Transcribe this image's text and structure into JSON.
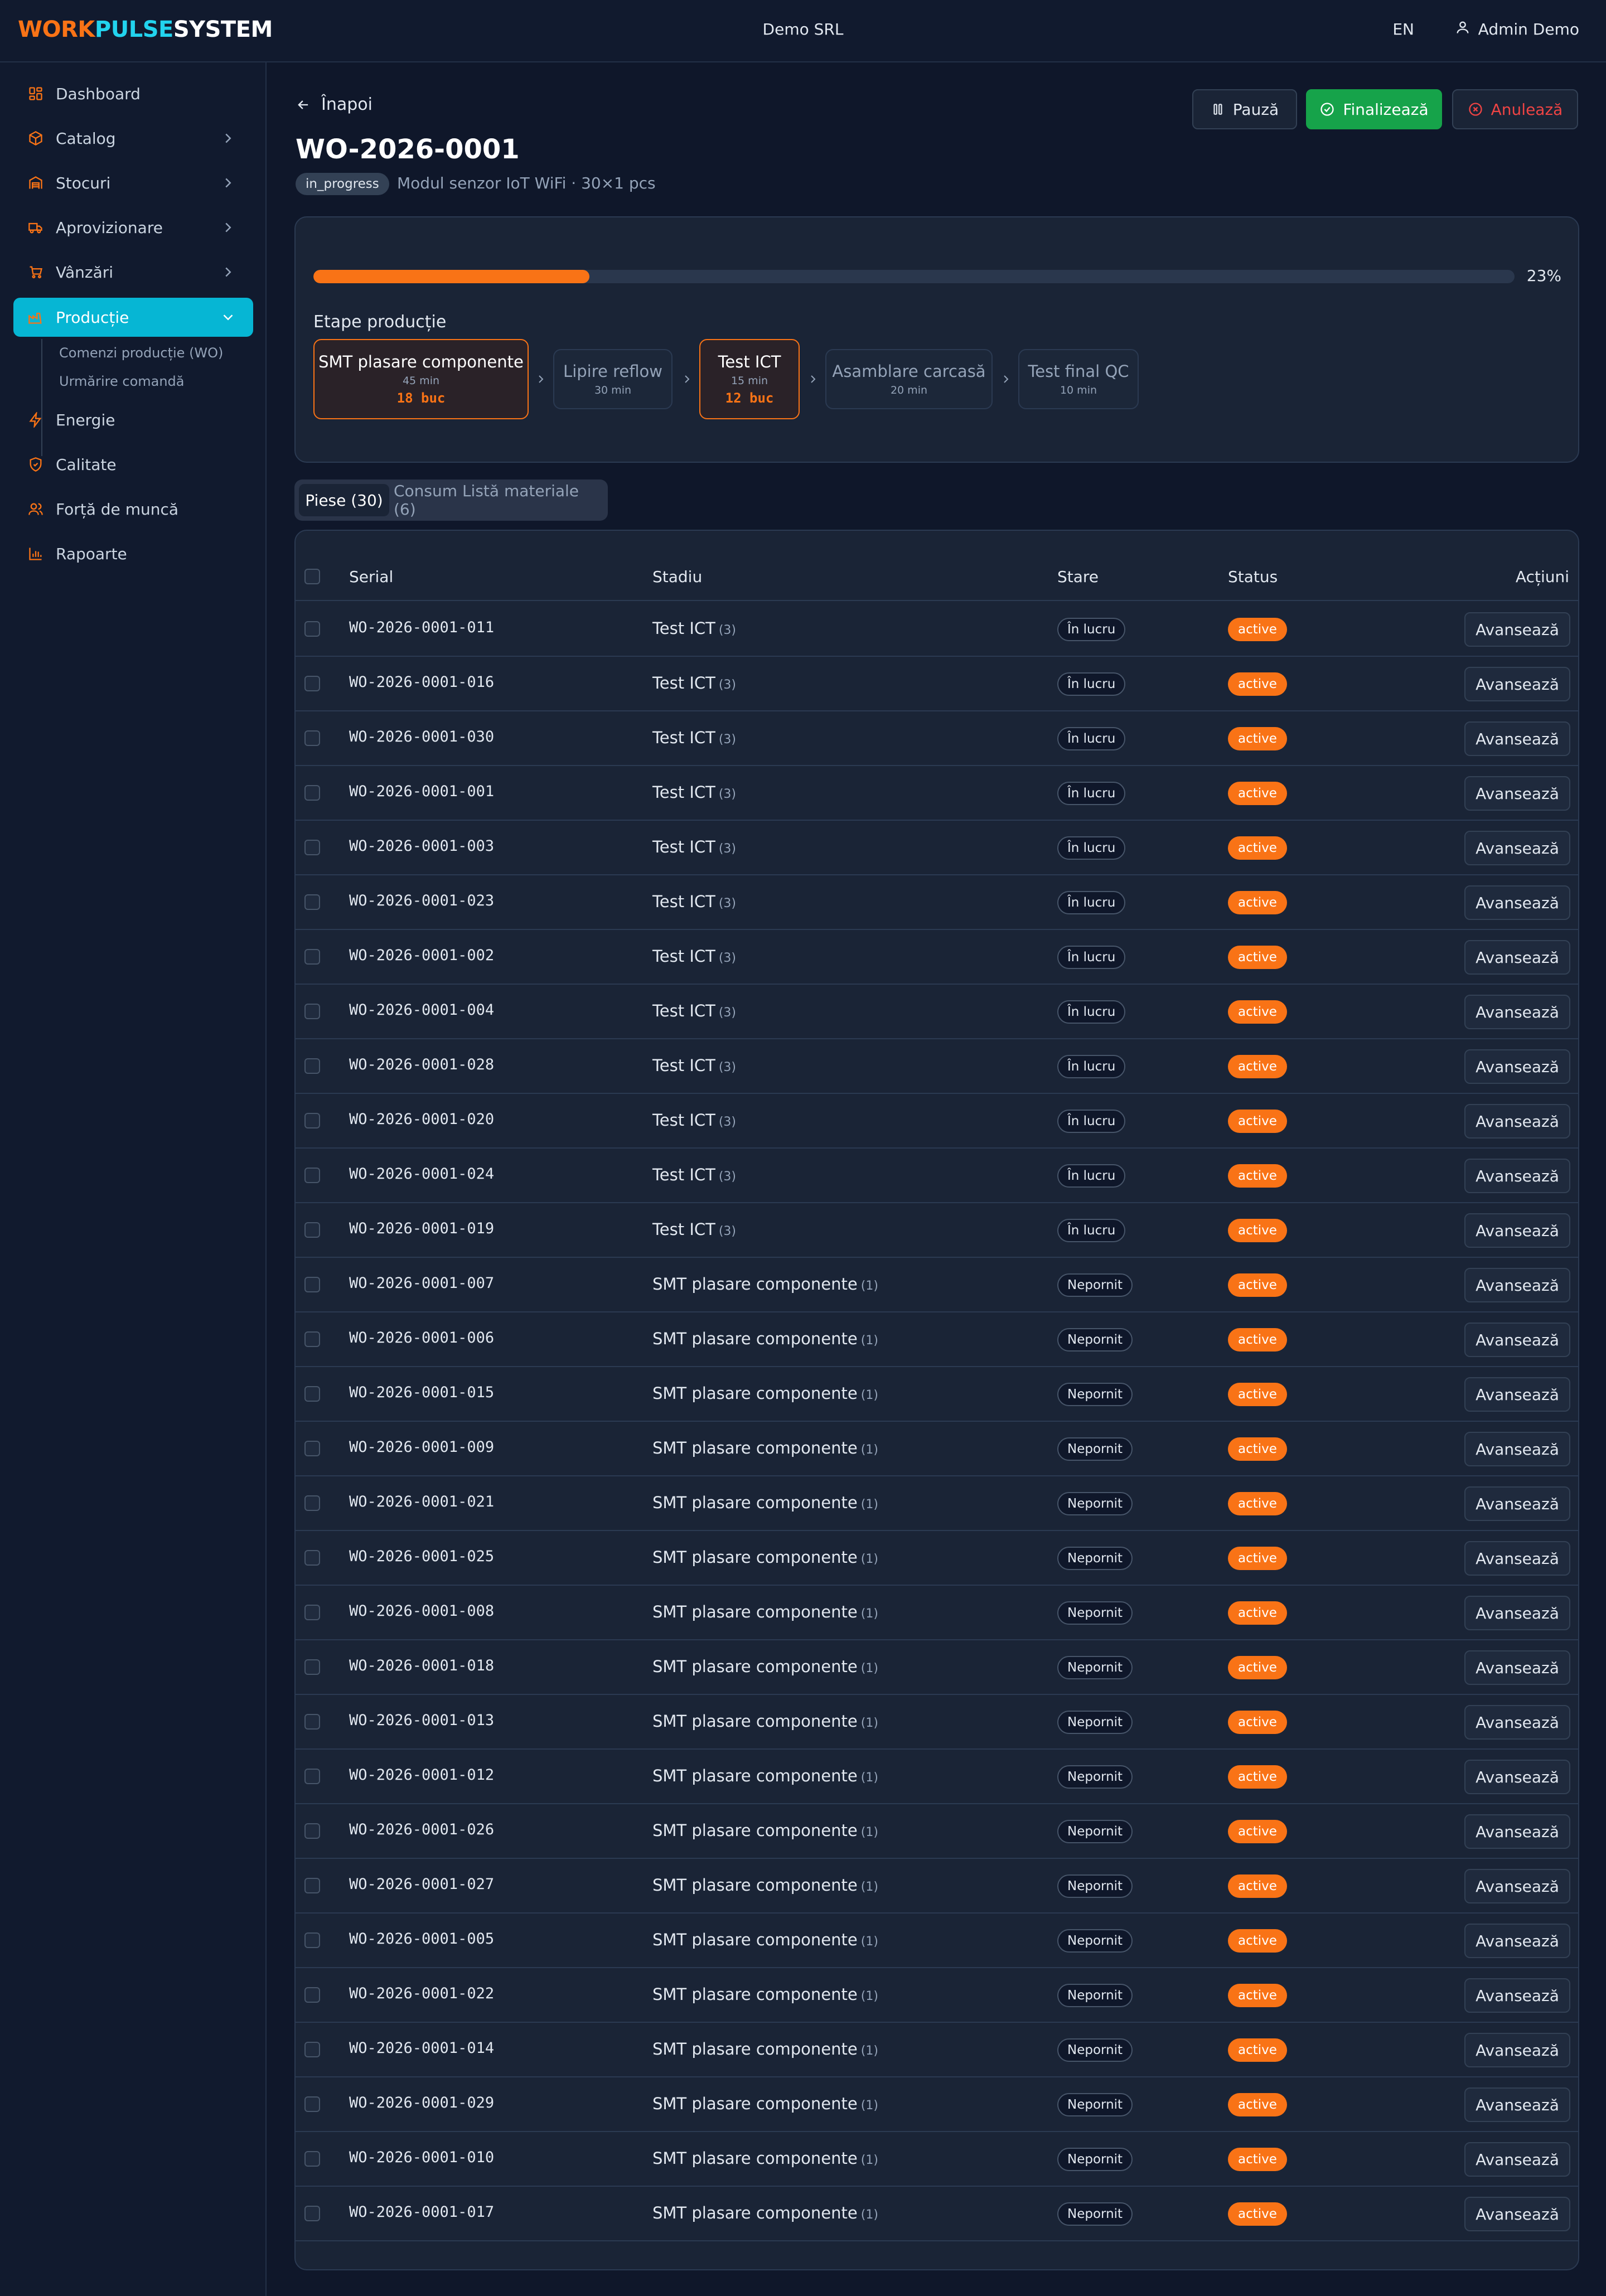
{
  "header": {
    "logo": {
      "part1": "WORK",
      "part2": "PULSE",
      "part3": "SYSTEM"
    },
    "company": "Demo SRL",
    "language": "EN",
    "user": "Admin Demo"
  },
  "sidebar": {
    "items": [
      {
        "label": "Dashboard",
        "icon": "grid-icon"
      },
      {
        "label": "Catalog",
        "icon": "box-icon"
      },
      {
        "label": "Stocuri",
        "icon": "warehouse-icon"
      },
      {
        "label": "Aprovizionare",
        "icon": "truck-icon"
      },
      {
        "label": "Vânzări",
        "icon": "cart-icon"
      },
      {
        "label": "Producție",
        "icon": "factory-icon"
      },
      {
        "label": "Energie",
        "icon": "bolt-icon"
      },
      {
        "label": "Calitate",
        "icon": "shield-icon"
      },
      {
        "label": "Forță de muncă",
        "icon": "users-icon"
      },
      {
        "label": "Rapoarte",
        "icon": "bar-chart-icon"
      }
    ],
    "subitems": [
      "Comenzi producție (WO)",
      "Urmărire comandă"
    ]
  },
  "page": {
    "back_label": "Înapoi",
    "title": "WO-2026-0001",
    "status_badge": "in_progress",
    "subtitle": "Modul senzor IoT WiFi · 30×1 pcs",
    "buttons": {
      "pause": "Pauză",
      "finish": "Finalizează",
      "cancel": "Anulează"
    },
    "progress_percent": 23,
    "progress_label": "23%",
    "stages_label": "Etape producție",
    "stages": [
      {
        "name": "SMT plasare componente",
        "duration": "45 min",
        "qty": "18 buc"
      },
      {
        "name": "Lipire reflow",
        "duration": "30 min",
        "qty": ""
      },
      {
        "name": "Test ICT",
        "duration": "15 min",
        "qty": "12 buc"
      },
      {
        "name": "Asamblare carcasă",
        "duration": "20 min",
        "qty": ""
      },
      {
        "name": "Test final QC",
        "duration": "10 min",
        "qty": ""
      }
    ],
    "tabs": [
      "Piese (30)",
      "Consum Listă materiale (6)"
    ]
  },
  "table": {
    "headers": {
      "serial": "Serial",
      "stadiu": "Stadiu",
      "stare": "Stare",
      "status": "Status",
      "actions": "Acțiuni"
    },
    "action_label": "Avansează",
    "rows": [
      {
        "serial": "WO-2026-0001-011",
        "stadiu": "Test ICT",
        "step": "(3)",
        "stare": "În lucru",
        "status": "active"
      },
      {
        "serial": "WO-2026-0001-016",
        "stadiu": "Test ICT",
        "step": "(3)",
        "stare": "În lucru",
        "status": "active"
      },
      {
        "serial": "WO-2026-0001-030",
        "stadiu": "Test ICT",
        "step": "(3)",
        "stare": "În lucru",
        "status": "active"
      },
      {
        "serial": "WO-2026-0001-001",
        "stadiu": "Test ICT",
        "step": "(3)",
        "stare": "În lucru",
        "status": "active"
      },
      {
        "serial": "WO-2026-0001-003",
        "stadiu": "Test ICT",
        "step": "(3)",
        "stare": "În lucru",
        "status": "active"
      },
      {
        "serial": "WO-2026-0001-023",
        "stadiu": "Test ICT",
        "step": "(3)",
        "stare": "În lucru",
        "status": "active"
      },
      {
        "serial": "WO-2026-0001-002",
        "stadiu": "Test ICT",
        "step": "(3)",
        "stare": "În lucru",
        "status": "active"
      },
      {
        "serial": "WO-2026-0001-004",
        "stadiu": "Test ICT",
        "step": "(3)",
        "stare": "În lucru",
        "status": "active"
      },
      {
        "serial": "WO-2026-0001-028",
        "stadiu": "Test ICT",
        "step": "(3)",
        "stare": "În lucru",
        "status": "active"
      },
      {
        "serial": "WO-2026-0001-020",
        "stadiu": "Test ICT",
        "step": "(3)",
        "stare": "În lucru",
        "status": "active"
      },
      {
        "serial": "WO-2026-0001-024",
        "stadiu": "Test ICT",
        "step": "(3)",
        "stare": "În lucru",
        "status": "active"
      },
      {
        "serial": "WO-2026-0001-019",
        "stadiu": "Test ICT",
        "step": "(3)",
        "stare": "În lucru",
        "status": "active"
      },
      {
        "serial": "WO-2026-0001-007",
        "stadiu": "SMT plasare componente",
        "step": "(1)",
        "stare": "Nepornit",
        "status": "active"
      },
      {
        "serial": "WO-2026-0001-006",
        "stadiu": "SMT plasare componente",
        "step": "(1)",
        "stare": "Nepornit",
        "status": "active"
      },
      {
        "serial": "WO-2026-0001-015",
        "stadiu": "SMT plasare componente",
        "step": "(1)",
        "stare": "Nepornit",
        "status": "active"
      },
      {
        "serial": "WO-2026-0001-009",
        "stadiu": "SMT plasare componente",
        "step": "(1)",
        "stare": "Nepornit",
        "status": "active"
      },
      {
        "serial": "WO-2026-0001-021",
        "stadiu": "SMT plasare componente",
        "step": "(1)",
        "stare": "Nepornit",
        "status": "active"
      },
      {
        "serial": "WO-2026-0001-025",
        "stadiu": "SMT plasare componente",
        "step": "(1)",
        "stare": "Nepornit",
        "status": "active"
      },
      {
        "serial": "WO-2026-0001-008",
        "stadiu": "SMT plasare componente",
        "step": "(1)",
        "stare": "Nepornit",
        "status": "active"
      },
      {
        "serial": "WO-2026-0001-018",
        "stadiu": "SMT plasare componente",
        "step": "(1)",
        "stare": "Nepornit",
        "status": "active"
      },
      {
        "serial": "WO-2026-0001-013",
        "stadiu": "SMT plasare componente",
        "step": "(1)",
        "stare": "Nepornit",
        "status": "active"
      },
      {
        "serial": "WO-2026-0001-012",
        "stadiu": "SMT plasare componente",
        "step": "(1)",
        "stare": "Nepornit",
        "status": "active"
      },
      {
        "serial": "WO-2026-0001-026",
        "stadiu": "SMT plasare componente",
        "step": "(1)",
        "stare": "Nepornit",
        "status": "active"
      },
      {
        "serial": "WO-2026-0001-027",
        "stadiu": "SMT plasare componente",
        "step": "(1)",
        "stare": "Nepornit",
        "status": "active"
      },
      {
        "serial": "WO-2026-0001-005",
        "stadiu": "SMT plasare componente",
        "step": "(1)",
        "stare": "Nepornit",
        "status": "active"
      },
      {
        "serial": "WO-2026-0001-022",
        "stadiu": "SMT plasare componente",
        "step": "(1)",
        "stare": "Nepornit",
        "status": "active"
      },
      {
        "serial": "WO-2026-0001-014",
        "stadiu": "SMT plasare componente",
        "step": "(1)",
        "stare": "Nepornit",
        "status": "active"
      },
      {
        "serial": "WO-2026-0001-029",
        "stadiu": "SMT plasare componente",
        "step": "(1)",
        "stare": "Nepornit",
        "status": "active"
      },
      {
        "serial": "WO-2026-0001-010",
        "stadiu": "SMT plasare componente",
        "step": "(1)",
        "stare": "Nepornit",
        "status": "active"
      },
      {
        "serial": "WO-2026-0001-017",
        "stadiu": "SMT plasare componente",
        "step": "(1)",
        "stare": "Nepornit",
        "status": "active"
      }
    ]
  },
  "colors": {
    "accent": "#f97316",
    "active_nav": "#06b6d4",
    "success": "#16a34a",
    "danger": "#ef4444",
    "background": "#0f172a"
  }
}
